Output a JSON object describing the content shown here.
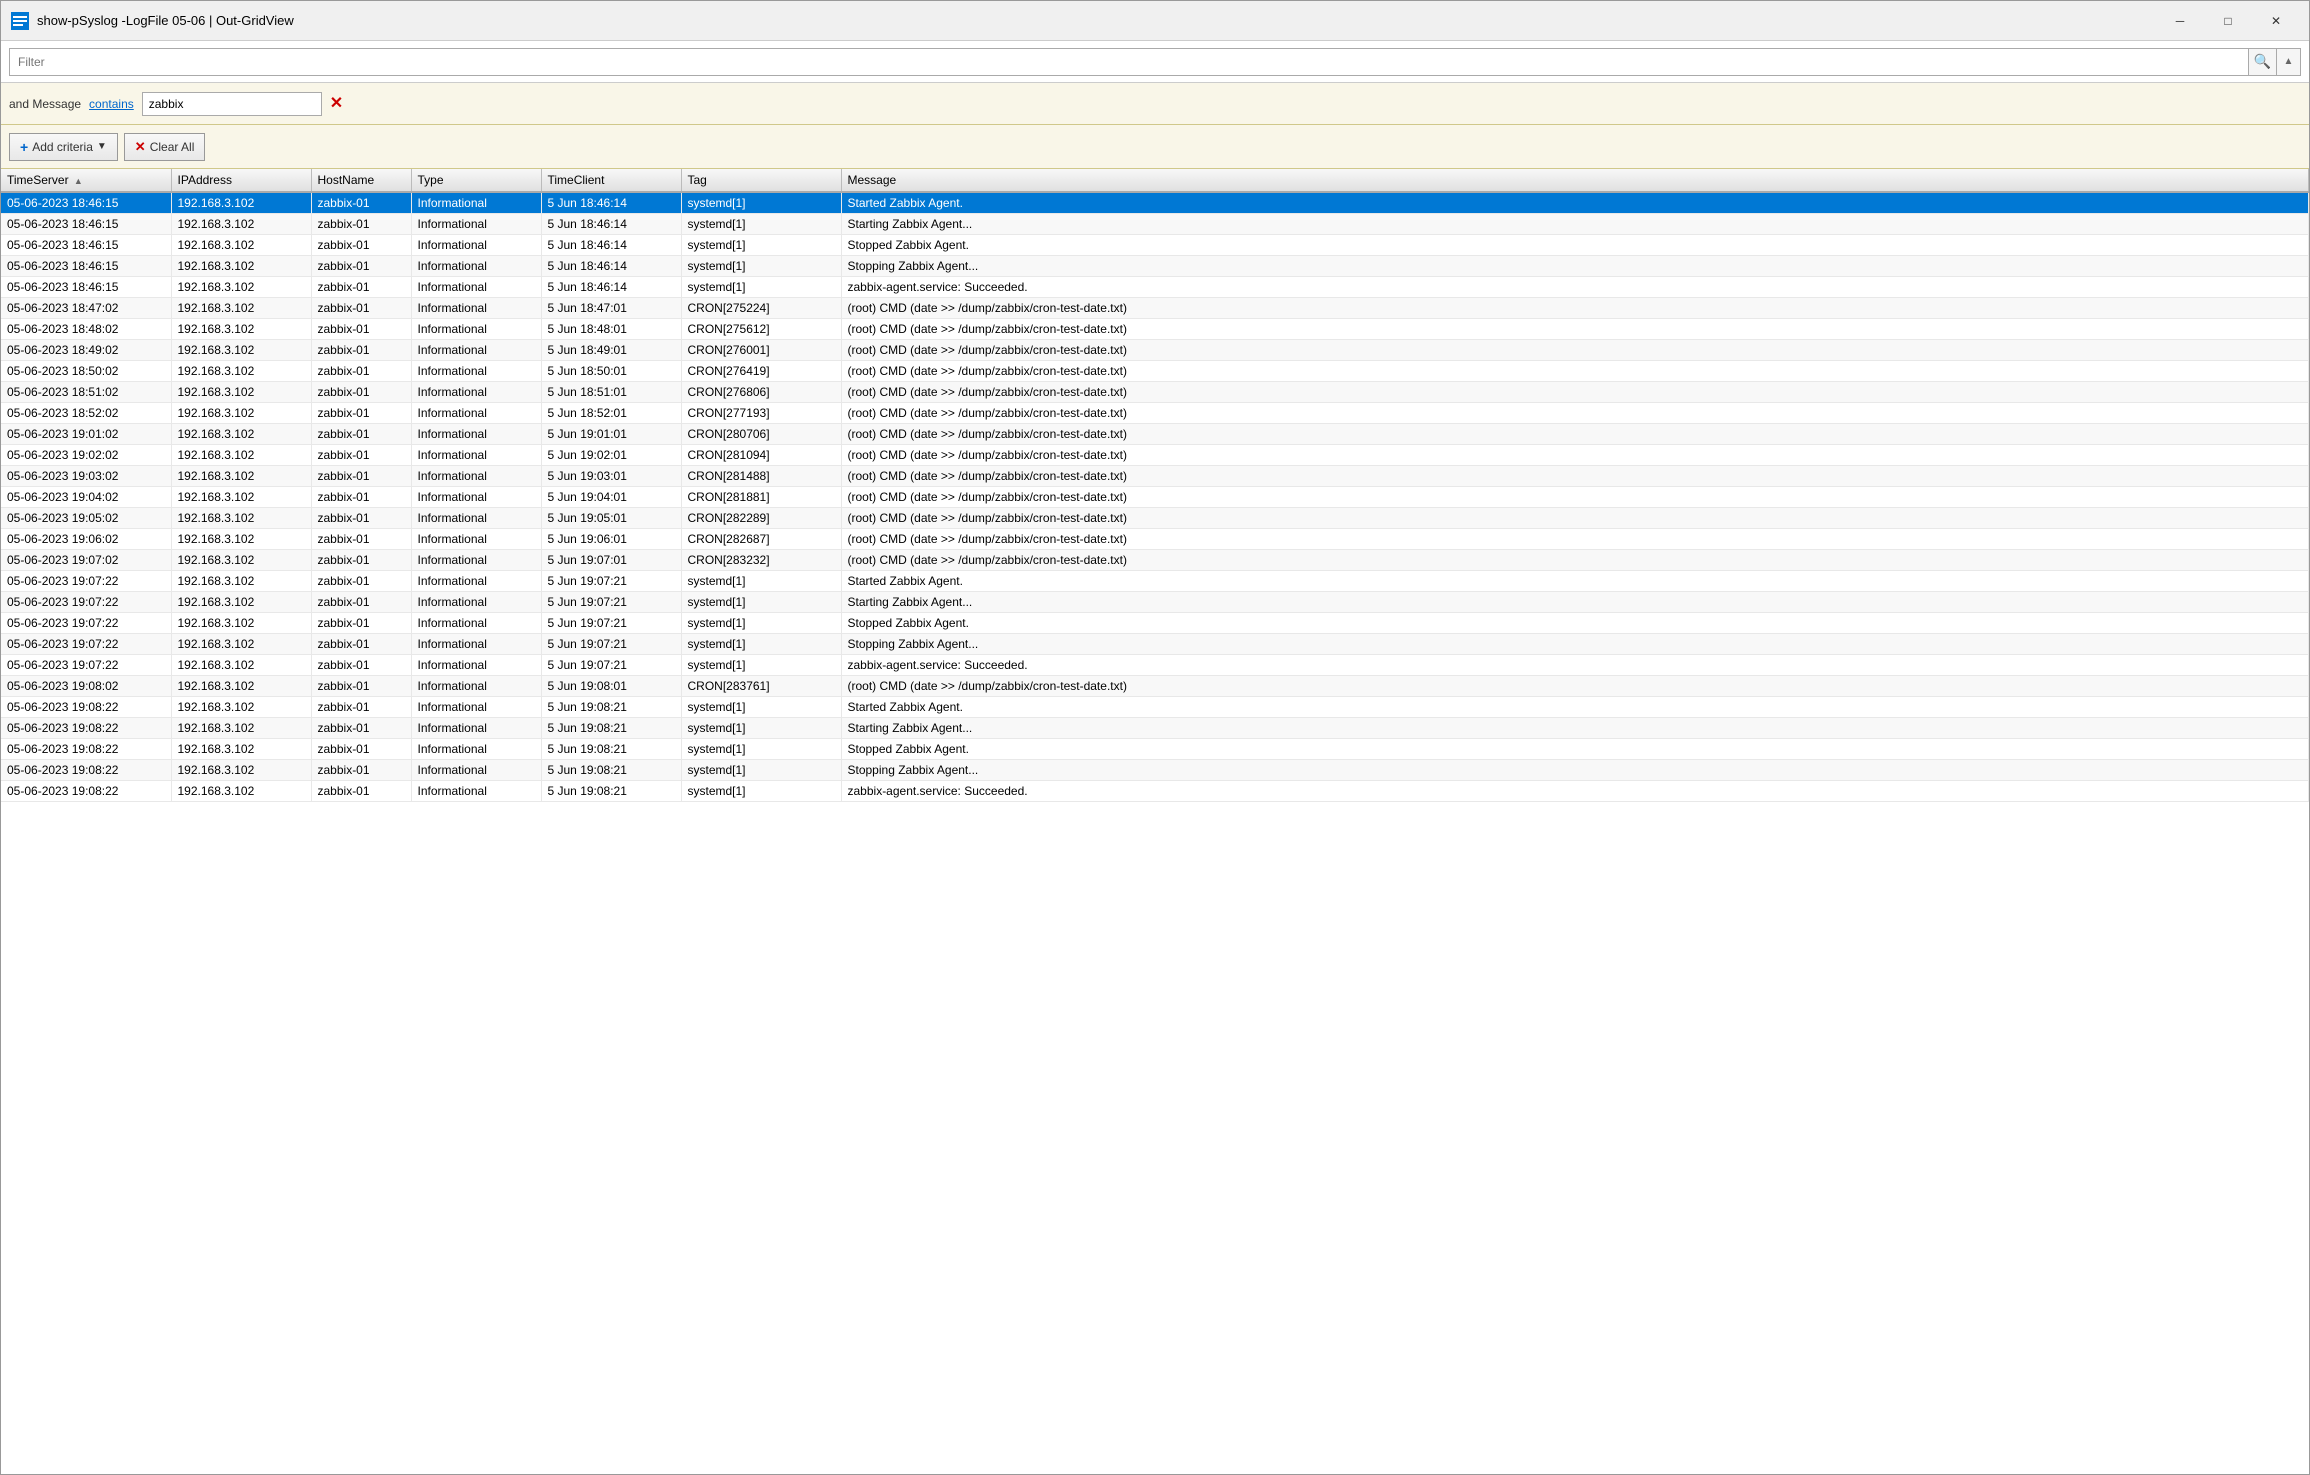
{
  "titleBar": {
    "title": "show-pSyslog -LogFile 05-06 | Out-GridView",
    "minimizeLabel": "─",
    "maximizeLabel": "□",
    "closeLabel": "✕"
  },
  "filterBar": {
    "placeholder": "Filter",
    "value": ""
  },
  "criteriaRow": {
    "prefixLabel": "and Message",
    "containsLabel": "contains",
    "value": "zabbix",
    "removeLabel": "✕"
  },
  "toolbar": {
    "addCriteriaLabel": "+ Add criteria",
    "addArrow": "▼",
    "clearAllLabel": "✕  Clear All"
  },
  "table": {
    "columns": [
      {
        "key": "timeserver",
        "label": "TimeServer",
        "sort": "▲"
      },
      {
        "key": "ipaddress",
        "label": "IPAddress"
      },
      {
        "key": "hostname",
        "label": "HostName"
      },
      {
        "key": "type",
        "label": "Type"
      },
      {
        "key": "timeclient",
        "label": "TimeClient"
      },
      {
        "key": "tag",
        "label": "Tag"
      },
      {
        "key": "message",
        "label": "Message"
      }
    ],
    "rows": [
      {
        "timeserver": "05-06-2023 18:46:15",
        "ipaddress": "192.168.3.102",
        "hostname": "zabbix-01",
        "type": "Informational",
        "timeclient": "5 Jun 18:46:14",
        "tag": "systemd[1]",
        "message": "Started Zabbix Agent.",
        "selected": true
      },
      {
        "timeserver": "05-06-2023 18:46:15",
        "ipaddress": "192.168.3.102",
        "hostname": "zabbix-01",
        "type": "Informational",
        "timeclient": "5 Jun 18:46:14",
        "tag": "systemd[1]",
        "message": "Starting Zabbix Agent...",
        "selected": false
      },
      {
        "timeserver": "05-06-2023 18:46:15",
        "ipaddress": "192.168.3.102",
        "hostname": "zabbix-01",
        "type": "Informational",
        "timeclient": "5 Jun 18:46:14",
        "tag": "systemd[1]",
        "message": "Stopped Zabbix Agent.",
        "selected": false
      },
      {
        "timeserver": "05-06-2023 18:46:15",
        "ipaddress": "192.168.3.102",
        "hostname": "zabbix-01",
        "type": "Informational",
        "timeclient": "5 Jun 18:46:14",
        "tag": "systemd[1]",
        "message": "Stopping Zabbix Agent...",
        "selected": false
      },
      {
        "timeserver": "05-06-2023 18:46:15",
        "ipaddress": "192.168.3.102",
        "hostname": "zabbix-01",
        "type": "Informational",
        "timeclient": "5 Jun 18:46:14",
        "tag": "systemd[1]",
        "message": "zabbix-agent.service: Succeeded.",
        "selected": false
      },
      {
        "timeserver": "05-06-2023 18:47:02",
        "ipaddress": "192.168.3.102",
        "hostname": "zabbix-01",
        "type": "Informational",
        "timeclient": "5 Jun 18:47:01",
        "tag": "CRON[275224]",
        "message": "(root) CMD (date >> /dump/zabbix/cron-test-date.txt)",
        "selected": false
      },
      {
        "timeserver": "05-06-2023 18:48:02",
        "ipaddress": "192.168.3.102",
        "hostname": "zabbix-01",
        "type": "Informational",
        "timeclient": "5 Jun 18:48:01",
        "tag": "CRON[275612]",
        "message": "(root) CMD (date >> /dump/zabbix/cron-test-date.txt)",
        "selected": false
      },
      {
        "timeserver": "05-06-2023 18:49:02",
        "ipaddress": "192.168.3.102",
        "hostname": "zabbix-01",
        "type": "Informational",
        "timeclient": "5 Jun 18:49:01",
        "tag": "CRON[276001]",
        "message": "(root) CMD (date >> /dump/zabbix/cron-test-date.txt)",
        "selected": false
      },
      {
        "timeserver": "05-06-2023 18:50:02",
        "ipaddress": "192.168.3.102",
        "hostname": "zabbix-01",
        "type": "Informational",
        "timeclient": "5 Jun 18:50:01",
        "tag": "CRON[276419]",
        "message": "(root) CMD (date >> /dump/zabbix/cron-test-date.txt)",
        "selected": false
      },
      {
        "timeserver": "05-06-2023 18:51:02",
        "ipaddress": "192.168.3.102",
        "hostname": "zabbix-01",
        "type": "Informational",
        "timeclient": "5 Jun 18:51:01",
        "tag": "CRON[276806]",
        "message": "(root) CMD (date >> /dump/zabbix/cron-test-date.txt)",
        "selected": false
      },
      {
        "timeserver": "05-06-2023 18:52:02",
        "ipaddress": "192.168.3.102",
        "hostname": "zabbix-01",
        "type": "Informational",
        "timeclient": "5 Jun 18:52:01",
        "tag": "CRON[277193]",
        "message": "(root) CMD (date >> /dump/zabbix/cron-test-date.txt)",
        "selected": false
      },
      {
        "timeserver": "05-06-2023 19:01:02",
        "ipaddress": "192.168.3.102",
        "hostname": "zabbix-01",
        "type": "Informational",
        "timeclient": "5 Jun 19:01:01",
        "tag": "CRON[280706]",
        "message": "(root) CMD (date >> /dump/zabbix/cron-test-date.txt)",
        "selected": false
      },
      {
        "timeserver": "05-06-2023 19:02:02",
        "ipaddress": "192.168.3.102",
        "hostname": "zabbix-01",
        "type": "Informational",
        "timeclient": "5 Jun 19:02:01",
        "tag": "CRON[281094]",
        "message": "(root) CMD (date >> /dump/zabbix/cron-test-date.txt)",
        "selected": false
      },
      {
        "timeserver": "05-06-2023 19:03:02",
        "ipaddress": "192.168.3.102",
        "hostname": "zabbix-01",
        "type": "Informational",
        "timeclient": "5 Jun 19:03:01",
        "tag": "CRON[281488]",
        "message": "(root) CMD (date >> /dump/zabbix/cron-test-date.txt)",
        "selected": false
      },
      {
        "timeserver": "05-06-2023 19:04:02",
        "ipaddress": "192.168.3.102",
        "hostname": "zabbix-01",
        "type": "Informational",
        "timeclient": "5 Jun 19:04:01",
        "tag": "CRON[281881]",
        "message": "(root) CMD (date >> /dump/zabbix/cron-test-date.txt)",
        "selected": false
      },
      {
        "timeserver": "05-06-2023 19:05:02",
        "ipaddress": "192.168.3.102",
        "hostname": "zabbix-01",
        "type": "Informational",
        "timeclient": "5 Jun 19:05:01",
        "tag": "CRON[282289]",
        "message": "(root) CMD (date >> /dump/zabbix/cron-test-date.txt)",
        "selected": false
      },
      {
        "timeserver": "05-06-2023 19:06:02",
        "ipaddress": "192.168.3.102",
        "hostname": "zabbix-01",
        "type": "Informational",
        "timeclient": "5 Jun 19:06:01",
        "tag": "CRON[282687]",
        "message": "(root) CMD (date >> /dump/zabbix/cron-test-date.txt)",
        "selected": false
      },
      {
        "timeserver": "05-06-2023 19:07:02",
        "ipaddress": "192.168.3.102",
        "hostname": "zabbix-01",
        "type": "Informational",
        "timeclient": "5 Jun 19:07:01",
        "tag": "CRON[283232]",
        "message": "(root) CMD (date >> /dump/zabbix/cron-test-date.txt)",
        "selected": false
      },
      {
        "timeserver": "05-06-2023 19:07:22",
        "ipaddress": "192.168.3.102",
        "hostname": "zabbix-01",
        "type": "Informational",
        "timeclient": "5 Jun 19:07:21",
        "tag": "systemd[1]",
        "message": "Started Zabbix Agent.",
        "selected": false
      },
      {
        "timeserver": "05-06-2023 19:07:22",
        "ipaddress": "192.168.3.102",
        "hostname": "zabbix-01",
        "type": "Informational",
        "timeclient": "5 Jun 19:07:21",
        "tag": "systemd[1]",
        "message": "Starting Zabbix Agent...",
        "selected": false
      },
      {
        "timeserver": "05-06-2023 19:07:22",
        "ipaddress": "192.168.3.102",
        "hostname": "zabbix-01",
        "type": "Informational",
        "timeclient": "5 Jun 19:07:21",
        "tag": "systemd[1]",
        "message": "Stopped Zabbix Agent.",
        "selected": false
      },
      {
        "timeserver": "05-06-2023 19:07:22",
        "ipaddress": "192.168.3.102",
        "hostname": "zabbix-01",
        "type": "Informational",
        "timeclient": "5 Jun 19:07:21",
        "tag": "systemd[1]",
        "message": "Stopping Zabbix Agent...",
        "selected": false
      },
      {
        "timeserver": "05-06-2023 19:07:22",
        "ipaddress": "192.168.3.102",
        "hostname": "zabbix-01",
        "type": "Informational",
        "timeclient": "5 Jun 19:07:21",
        "tag": "systemd[1]",
        "message": "zabbix-agent.service: Succeeded.",
        "selected": false
      },
      {
        "timeserver": "05-06-2023 19:08:02",
        "ipaddress": "192.168.3.102",
        "hostname": "zabbix-01",
        "type": "Informational",
        "timeclient": "5 Jun 19:08:01",
        "tag": "CRON[283761]",
        "message": "(root) CMD (date >> /dump/zabbix/cron-test-date.txt)",
        "selected": false
      },
      {
        "timeserver": "05-06-2023 19:08:22",
        "ipaddress": "192.168.3.102",
        "hostname": "zabbix-01",
        "type": "Informational",
        "timeclient": "5 Jun 19:08:21",
        "tag": "systemd[1]",
        "message": "Started Zabbix Agent.",
        "selected": false
      },
      {
        "timeserver": "05-06-2023 19:08:22",
        "ipaddress": "192.168.3.102",
        "hostname": "zabbix-01",
        "type": "Informational",
        "timeclient": "5 Jun 19:08:21",
        "tag": "systemd[1]",
        "message": "Starting Zabbix Agent...",
        "selected": false
      },
      {
        "timeserver": "05-06-2023 19:08:22",
        "ipaddress": "192.168.3.102",
        "hostname": "zabbix-01",
        "type": "Informational",
        "timeclient": "5 Jun 19:08:21",
        "tag": "systemd[1]",
        "message": "Stopped Zabbix Agent.",
        "selected": false
      },
      {
        "timeserver": "05-06-2023 19:08:22",
        "ipaddress": "192.168.3.102",
        "hostname": "zabbix-01",
        "type": "Informational",
        "timeclient": "5 Jun 19:08:21",
        "tag": "systemd[1]",
        "message": "Stopping Zabbix Agent...",
        "selected": false
      },
      {
        "timeserver": "05-06-2023 19:08:22",
        "ipaddress": "192.168.3.102",
        "hostname": "zabbix-01",
        "type": "Informational",
        "timeclient": "5 Jun 19:08:21",
        "tag": "systemd[1]",
        "message": "zabbix-agent.service: Succeeded.",
        "selected": false
      }
    ]
  }
}
